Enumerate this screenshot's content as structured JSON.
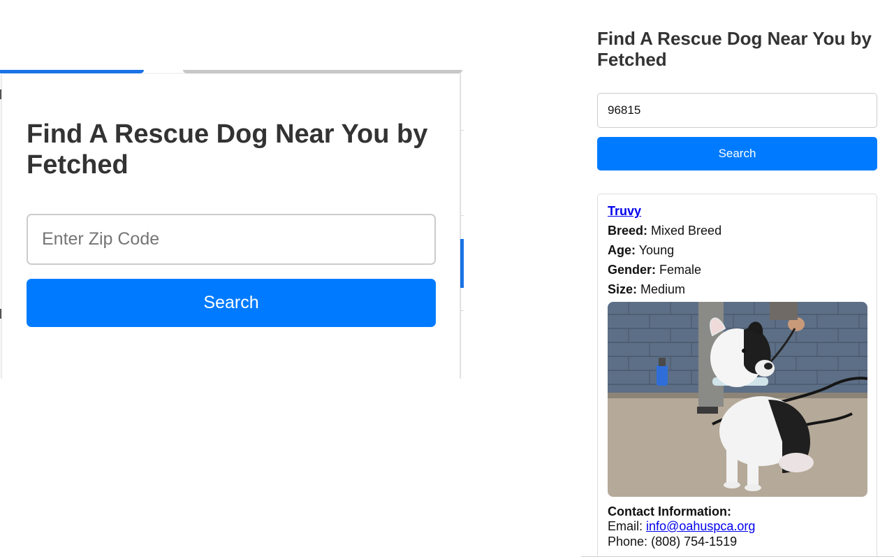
{
  "left_view": {
    "title": "Find A Rescue Dog Near You by Fetched",
    "zip_placeholder": "Enter Zip Code",
    "search_label": "Search"
  },
  "right_view": {
    "title": "Find A Rescue Dog Near You by Fetched",
    "zip_value": "96815",
    "search_label": "Search",
    "dog": {
      "name": "Truvy",
      "breed_label": "Breed:",
      "breed": "Mixed Breed",
      "age_label": "Age:",
      "age": "Young",
      "gender_label": "Gender:",
      "gender": "Female",
      "size_label": "Size:",
      "size": "Medium",
      "contact_heading": "Contact Information:",
      "email_label": "Email:",
      "email": "info@oahuspca.org",
      "phone_label": "Phone:",
      "phone": "(808) 754-1519"
    }
  },
  "colors": {
    "primary_button": "#007bff",
    "link": "#0000ee",
    "heading": "#333333"
  }
}
